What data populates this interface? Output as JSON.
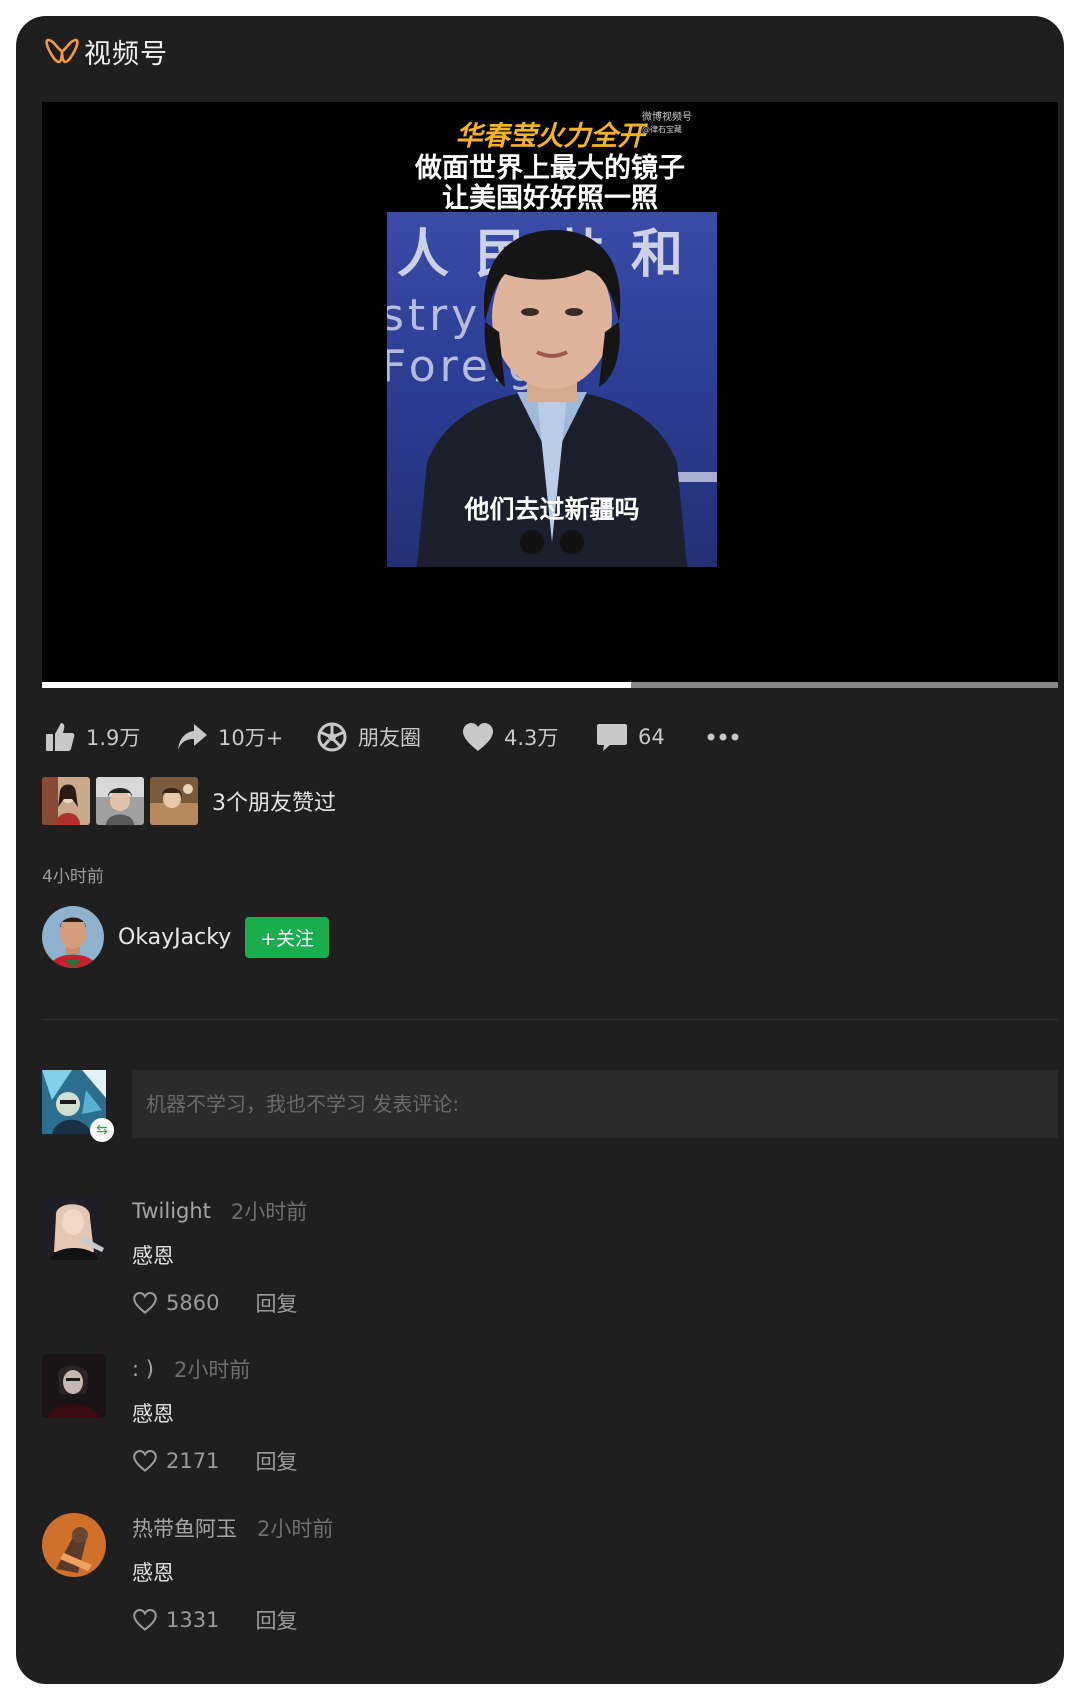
{
  "app": {
    "title": "视频号"
  },
  "video": {
    "caption_line1": "华春莹火力全开",
    "caption_line2": "做面世界上最大的镜子",
    "caption_line3": "让美国好好照一照",
    "watermark_line1": "微博视频号",
    "watermark_line2": "@律石宝藏",
    "background_text1": "人民共和",
    "background_text2": "stry of Foreign",
    "subtitle": "他们去过新疆吗",
    "progress": 0.58
  },
  "actions": {
    "like": {
      "icon": "thumbs-up-icon",
      "label": "1.9万"
    },
    "share": {
      "icon": "share-arrow-icon",
      "label": "10万+"
    },
    "moments": {
      "icon": "moments-aperture-icon",
      "label": "朋友圈"
    },
    "heart": {
      "icon": "heart-icon",
      "label": "4.3万"
    },
    "comment": {
      "icon": "comment-bubble-icon",
      "label": "64"
    },
    "more": {
      "icon": "more-dots-icon"
    }
  },
  "friends_liked": {
    "text": "3个朋友赞过",
    "count": 3
  },
  "post_time": "4小时前",
  "author": {
    "name": "OkayJacky",
    "follow_label": "+关注"
  },
  "comment_input": {
    "placeholder": "机器不学习，我也不学习 发表评论:"
  },
  "comments": [
    {
      "name": "Twilight",
      "time": "2小时前",
      "text": "感恩",
      "likes": "5860",
      "reply": "回复"
    },
    {
      "name": ": )",
      "time": "2小时前",
      "text": "感恩",
      "likes": "2171",
      "reply": "回复"
    },
    {
      "name": "热带鱼阿玉",
      "time": "2小时前",
      "text": "感恩",
      "likes": "1331",
      "reply": "回复"
    }
  ],
  "colors": {
    "background": "#1f1f1f",
    "accent_green": "#1aad4e",
    "logo_orange": "#f39a4a",
    "caption_yellow": "#f5b325"
  }
}
